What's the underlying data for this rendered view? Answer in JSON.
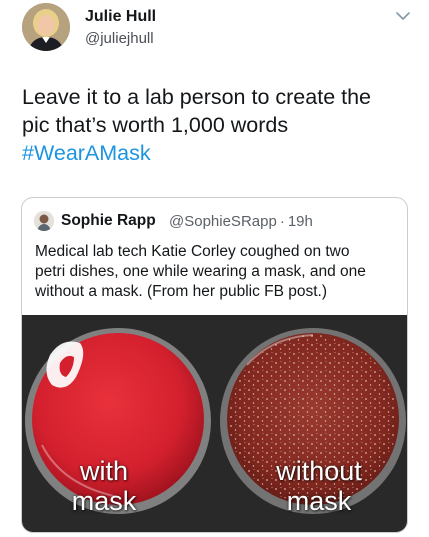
{
  "author": {
    "name": "Julie Hull",
    "handle": "@juliejhull",
    "avatar_icon": "profile-photo",
    "menu_icon": "chevron-down-icon"
  },
  "tweet": {
    "lines": [
      "Leave it to a lab person to create the",
      "pic that’s worth 1,000 words"
    ],
    "hashtag": "#WearAMask",
    "hashtag_color": "#1b95e0"
  },
  "quoted_tweet": {
    "author_name": "Sophie Rapp",
    "author_handle": "@SophieSRapp",
    "separator": "·",
    "time": "19h",
    "text_lines": [
      "Medical lab tech Katie Corley coughed on two",
      "petri dishes, one while wearing a mask, and one",
      "without a mask. (From her public FB post.)"
    ],
    "photo": {
      "left_label_lines": [
        "with",
        "mask"
      ],
      "right_label_lines": [
        "without",
        "mask"
      ],
      "left_dish_color": "#d4202e",
      "right_dish_color": "#8a2a24",
      "background_color": "#2b2b2b"
    }
  }
}
